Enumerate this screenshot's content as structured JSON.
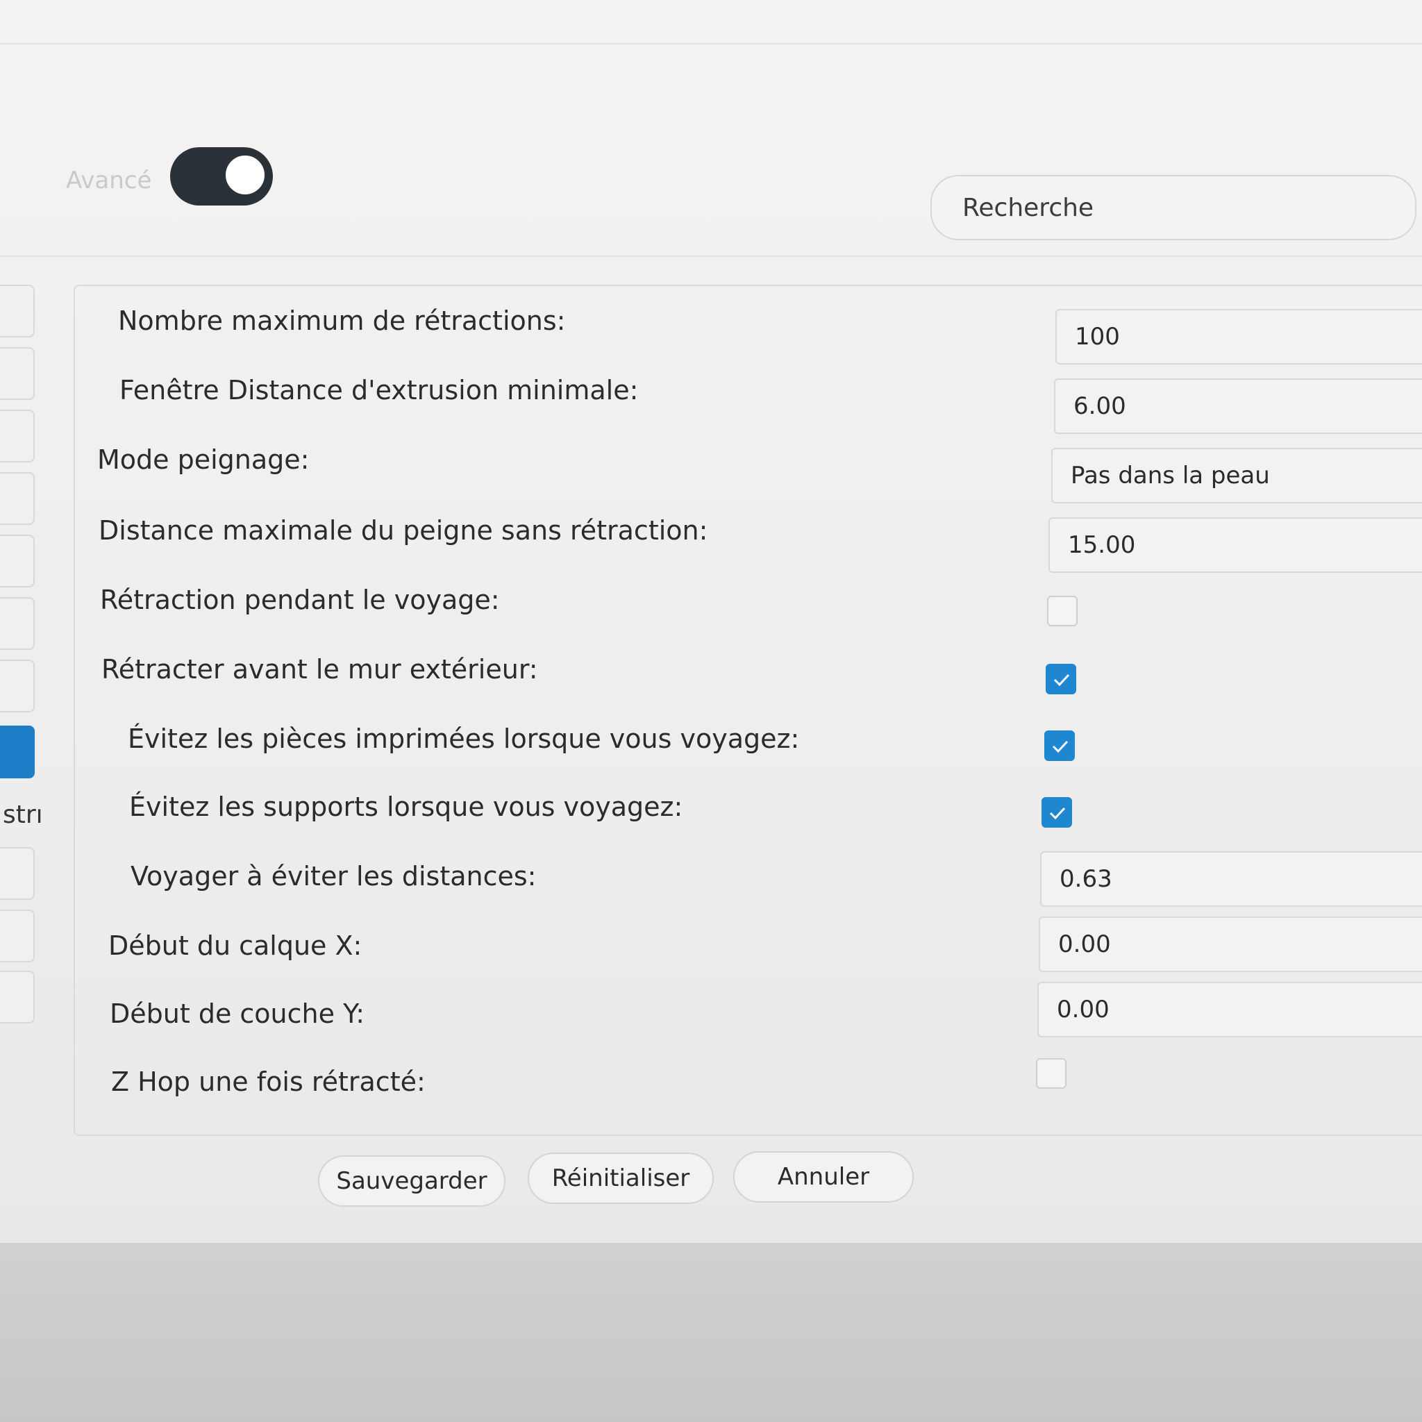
{
  "header": {
    "advanced_label": "Avancé",
    "advanced_toggle_on": true,
    "search_placeholder": "Recherche"
  },
  "sidebar": {
    "partial_text": "strı"
  },
  "settings": [
    {
      "label": "Nombre maximum de rétractions:",
      "type": "input",
      "value": "100"
    },
    {
      "label": "Fenêtre Distance d'extrusion minimale:",
      "type": "input",
      "value": "6.00"
    },
    {
      "label": "Mode peignage:",
      "type": "select",
      "value": "Pas dans la peau"
    },
    {
      "label": "Distance maximale du peigne sans rétraction:",
      "type": "input",
      "value": "15.00"
    },
    {
      "label": "Rétraction pendant le voyage:",
      "type": "checkbox",
      "checked": false
    },
    {
      "label": "Rétracter avant le mur extérieur:",
      "type": "checkbox",
      "checked": true
    },
    {
      "label": "Évitez les pièces imprimées lorsque vous voyagez:",
      "type": "checkbox",
      "checked": true
    },
    {
      "label": "Évitez les supports lorsque vous voyagez:",
      "type": "checkbox",
      "checked": true
    },
    {
      "label": "Voyager à éviter les distances:",
      "type": "input",
      "value": "0.63"
    },
    {
      "label": "Début du calque X:",
      "type": "input",
      "value": "0.00"
    },
    {
      "label": "Début de couche Y:",
      "type": "input",
      "value": "0.00"
    },
    {
      "label": "Z Hop une fois rétracté:",
      "type": "checkbox",
      "checked": false
    }
  ],
  "buttons": {
    "save": "Sauvegarder",
    "reset": "Réinitialiser",
    "cancel": "Annuler"
  },
  "colors": {
    "accent": "#1f86d0",
    "toggle": "#2b3138"
  }
}
